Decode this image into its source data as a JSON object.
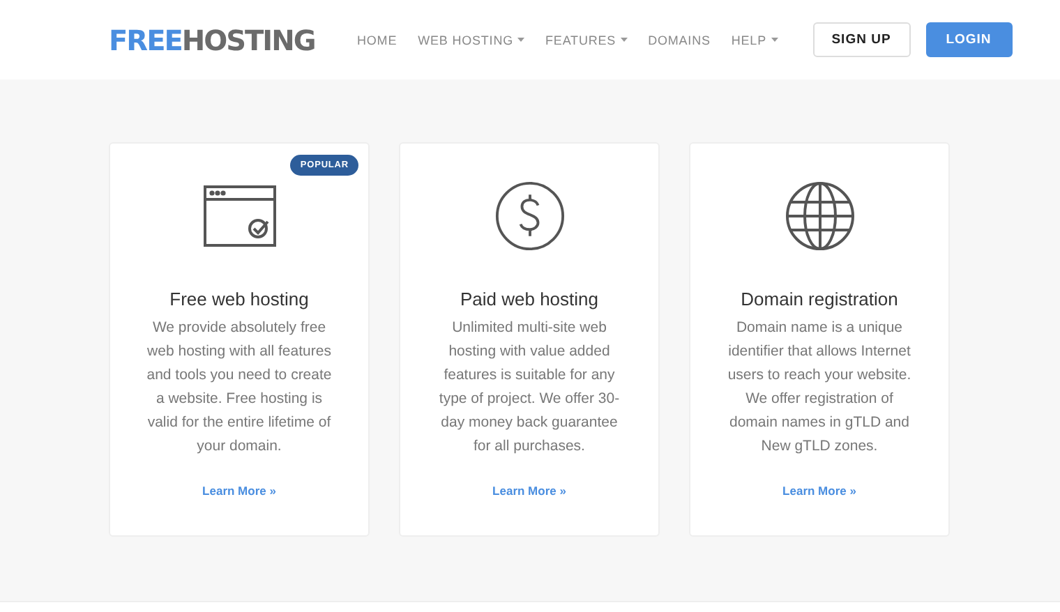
{
  "logo": {
    "accent": "FREE",
    "rest": "HOSTING"
  },
  "nav": [
    {
      "label": "HOME",
      "has_menu": false
    },
    {
      "label": "WEB HOSTING",
      "has_menu": true
    },
    {
      "label": "FEATURES",
      "has_menu": true
    },
    {
      "label": "DOMAINS",
      "has_menu": false
    },
    {
      "label": "HELP",
      "has_menu": true
    }
  ],
  "buttons": [
    {
      "label": "SIGN UP",
      "kind": "outline"
    },
    {
      "label": "LOGIN",
      "kind": "primary"
    }
  ],
  "cards": [
    {
      "kind": "browser",
      "badge": "POPULAR",
      "title": "Free web hosting",
      "text": "We provide absolutely free web hosting with all features and tools you need to create a website. Free hosting is valid for the entire lifetime of your domain.",
      "link": "Learn More »"
    },
    {
      "kind": "dollar",
      "title": "Paid web hosting",
      "text": "Unlimited multi-site web hosting with value added features is suitable for any type of project. We offer 30-day money back guarantee for all purchases.",
      "link": "Learn More »"
    },
    {
      "kind": "globe",
      "title": "Domain registration",
      "text": "Domain name is a unique identifier that allows Internet users to reach your website. We offer registration of domain names in gTLD and New gTLD zones.",
      "link": "Learn More »"
    }
  ]
}
